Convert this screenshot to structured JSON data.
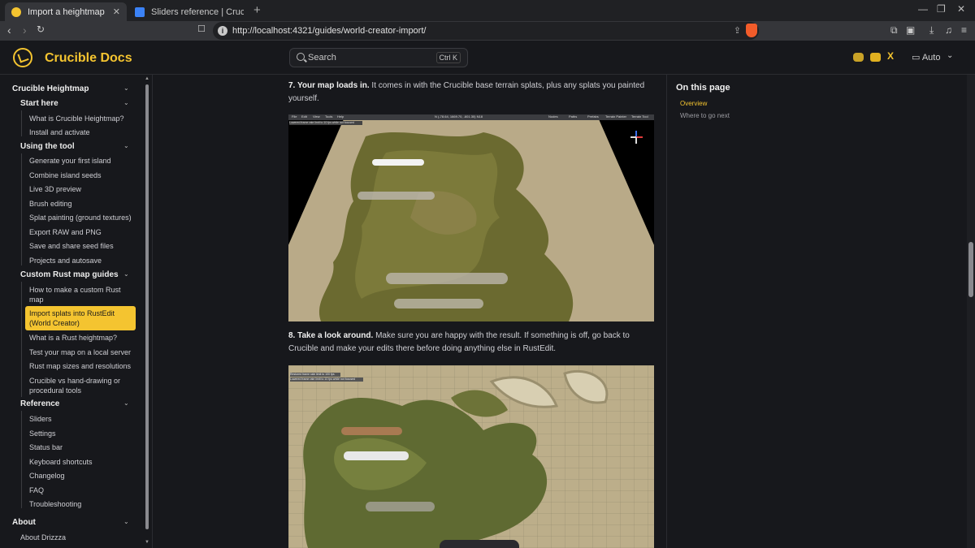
{
  "browser": {
    "tabs": [
      {
        "title": "Import a heightmap and splats i",
        "active": true
      },
      {
        "title": "Sliders reference | Crucible Docs - Bra",
        "active": false
      }
    ],
    "url": "http://localhost:4321/guides/world-creator-import/"
  },
  "site": {
    "title": "Crucible Docs",
    "search_label": "Search",
    "search_shortcut": "Ctrl K",
    "theme_label": "Auto",
    "accent": "#f4c430"
  },
  "sidebar": {
    "sections": [
      {
        "label": "Crucible Heightmap"
      },
      {
        "label": "Start here"
      },
      {
        "label": "Using the tool"
      },
      {
        "label": "Custom Rust map guides"
      },
      {
        "label": "Reference"
      },
      {
        "label": "About"
      }
    ],
    "items": {
      "what_is": "What is Crucible Heightmap?",
      "install": "Install and activate",
      "generate": "Generate your first island",
      "combine": "Combine island seeds",
      "live3d": "Live 3D preview",
      "brush": "Brush editing",
      "splat": "Splat painting (ground textures)",
      "export": "Export RAW and PNG",
      "save": "Save and share seed files",
      "projects": "Projects and autosave",
      "custom_map_1": "How to make a custom Rust",
      "custom_map_2": "map",
      "import_1": "Import splats into RustEdit",
      "import_2": "(World Creator)",
      "rust_heightmap": "What is a Rust heightmap?",
      "test": "Test your map on a local server",
      "sizes": "Rust map sizes and resolutions",
      "vs_1": "Crucible vs hand-drawing or",
      "vs_2": "procedural tools",
      "sliders": "Sliders",
      "settings": "Settings",
      "status": "Status bar",
      "keyboard": "Keyboard shortcuts",
      "changelog": "Changelog",
      "faq": "FAQ",
      "troubleshooting": "Troubleshooting",
      "about_drizzza": "About Drizzza"
    }
  },
  "content": {
    "step7_bold": "7. Your map loads in.",
    "step7_text": " It comes in with the Crucible base terrain splats, plus any splats you painted yourself.",
    "step8_bold": "8. Take a look around.",
    "step8_text": " Make sure you are happy with the result. If something is off, go back to Crucible and make your edits there before doing anything else in RustEdit.",
    "shot1": {
      "menu": [
        "File",
        "Edit",
        "View",
        "Tools",
        "Help"
      ],
      "coords": "N (-78.64, 1669.70, -601.30) N18",
      "right_menu": [
        "Nodes",
        "Paths",
        "Prefabs",
        "Terrain Painter",
        "Terrain Tool"
      ],
      "fps_note": "Lowered frame rate limit to 10 fps while not focused"
    },
    "shot2": {
      "fps_note_1": "Restored frame rate limit to 100 fps",
      "fps_note_2": "Lowered frame rate limit to 10 fps while not focused"
    }
  },
  "toc": {
    "title": "On this page",
    "links": [
      "Overview",
      "Where to go next"
    ]
  }
}
